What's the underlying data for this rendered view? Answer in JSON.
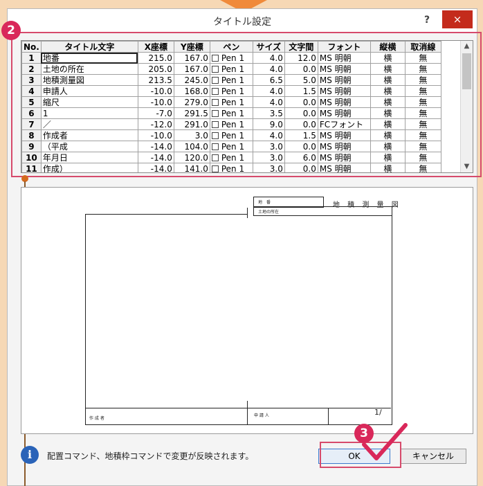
{
  "window": {
    "title": "タイトル設定",
    "help": "?",
    "close": "×"
  },
  "markers": {
    "grid": "2",
    "ok": "3"
  },
  "grid": {
    "columns": [
      "No.",
      "タイトル文字",
      "X座標",
      "Y座標",
      "ペン",
      "サイズ",
      "文字間",
      "フォント",
      "縦横",
      "取消線"
    ],
    "rows": [
      {
        "no": "1",
        "title": "地番",
        "x": "215.0",
        "y": "167.0",
        "pen": "Pen 1",
        "size": "4.0",
        "gap": "12.0",
        "font": "MS 明朝",
        "dir": "横",
        "strike": "無"
      },
      {
        "no": "2",
        "title": "土地の所在",
        "x": "205.0",
        "y": "167.0",
        "pen": "Pen 1",
        "size": "4.0",
        "gap": "0.0",
        "font": "MS 明朝",
        "dir": "横",
        "strike": "無"
      },
      {
        "no": "3",
        "title": "地積測量図",
        "x": "213.5",
        "y": "245.0",
        "pen": "Pen 1",
        "size": "6.5",
        "gap": "5.0",
        "font": "MS 明朝",
        "dir": "横",
        "strike": "無"
      },
      {
        "no": "4",
        "title": "申請人",
        "x": "-10.0",
        "y": "168.0",
        "pen": "Pen 1",
        "size": "4.0",
        "gap": "1.5",
        "font": "MS 明朝",
        "dir": "横",
        "strike": "無"
      },
      {
        "no": "5",
        "title": "縮尺",
        "x": "-10.0",
        "y": "279.0",
        "pen": "Pen 1",
        "size": "4.0",
        "gap": "0.0",
        "font": "MS 明朝",
        "dir": "横",
        "strike": "無"
      },
      {
        "no": "6",
        "title": "1",
        "x": "-7.0",
        "y": "291.5",
        "pen": "Pen 1",
        "size": "3.5",
        "gap": "0.0",
        "font": "MS 明朝",
        "dir": "横",
        "strike": "無"
      },
      {
        "no": "7",
        "title": "／",
        "x": "-12.0",
        "y": "291.0",
        "pen": "Pen 1",
        "size": "9.0",
        "gap": "0.0",
        "font": "FCフォント",
        "dir": "横",
        "strike": "無"
      },
      {
        "no": "8",
        "title": "作成者",
        "x": "-10.0",
        "y": "3.0",
        "pen": "Pen 1",
        "size": "4.0",
        "gap": "1.5",
        "font": "MS 明朝",
        "dir": "横",
        "strike": "無"
      },
      {
        "no": "9",
        "title": "（平成",
        "x": "-14.0",
        "y": "104.0",
        "pen": "Pen 1",
        "size": "3.0",
        "gap": "0.0",
        "font": "MS 明朝",
        "dir": "横",
        "strike": "無"
      },
      {
        "no": "10",
        "title": "年月日",
        "x": "-14.0",
        "y": "120.0",
        "pen": "Pen 1",
        "size": "3.0",
        "gap": "6.0",
        "font": "MS 明朝",
        "dir": "横",
        "strike": "無"
      },
      {
        "no": "11",
        "title": "作成）",
        "x": "-14.0",
        "y": "141.0",
        "pen": "Pen 1",
        "size": "3.0",
        "gap": "0.0",
        "font": "MS 明朝",
        "dir": "横",
        "strike": "無"
      }
    ]
  },
  "preview": {
    "sheet_title": "地 積 測 量 図",
    "label_chiban": "地　番",
    "label_shozai": "土地の所在",
    "label_sakusei": "作 成 者",
    "label_shinsei": "申 請 人",
    "scale": "1/"
  },
  "footer": {
    "message": "配置コマンド、地積枠コマンドで変更が反映されます。",
    "ok": "OK",
    "cancel": "キャンセル"
  }
}
